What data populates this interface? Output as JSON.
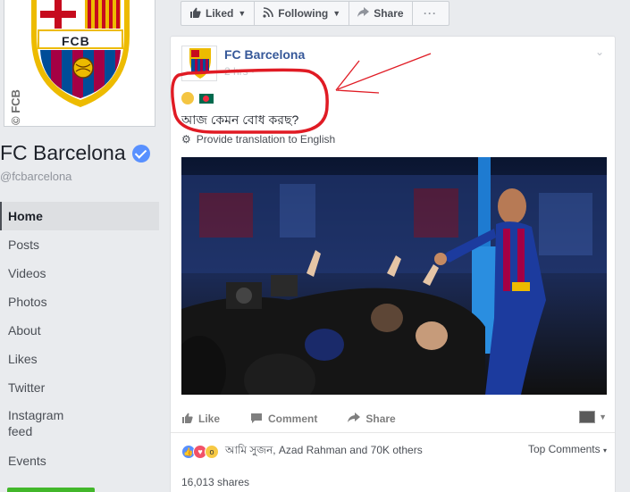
{
  "page": {
    "name": "FC Barcelona",
    "handle": "@fcbarcelona",
    "crest_text": "FCB",
    "vertical_watermark": "© FCB"
  },
  "nav": {
    "items": [
      {
        "label": "Home",
        "active": true
      },
      {
        "label": "Posts"
      },
      {
        "label": "Videos"
      },
      {
        "label": "Photos"
      },
      {
        "label": "About"
      },
      {
        "label": "Likes"
      },
      {
        "label": "Twitter"
      },
      {
        "label": "Instagram\nfeed"
      },
      {
        "label": "Events"
      }
    ]
  },
  "action_bar": {
    "liked_label": "Liked",
    "following_label": "Following",
    "share_label": "Share",
    "more_label": "···"
  },
  "post": {
    "author": "FC Barcelona",
    "time": "2 hrs · ",
    "text": "আজ কেমন বোধ করছ?",
    "translate_label": "Provide translation to English",
    "actions": {
      "like": "Like",
      "comment": "Comment",
      "share": "Share"
    },
    "reactors": "আমি সুজন, Azad Rahman and 70K others",
    "top_comments": "Top Comments",
    "shares": "16,013 shares"
  },
  "colors": {
    "link_blue": "#365899",
    "annotation_red": "#e01b24",
    "barca_blue": "#004d98",
    "barca_red": "#a50044",
    "gold": "#edbb00"
  },
  "icons": {
    "verified": "verified-badge-icon",
    "like": "thumbs-up-icon",
    "rss": "rss-icon",
    "share": "share-arrow-icon",
    "gear": "gear-icon"
  }
}
